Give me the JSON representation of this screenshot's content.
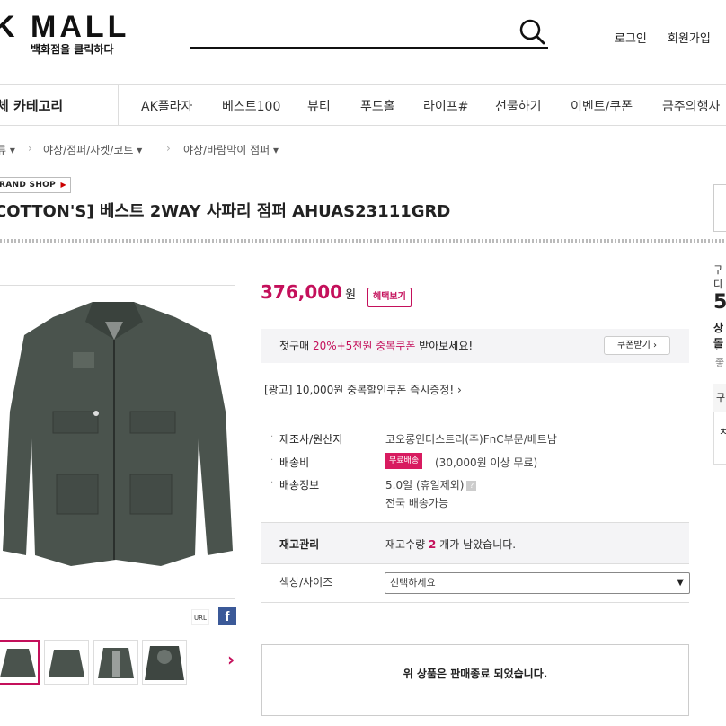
{
  "header": {
    "logo_text": "K MALL",
    "logo_sub": "백화점을 클릭하다",
    "search_placeholder": "",
    "login": "로그인",
    "join": "회원가입"
  },
  "nav": {
    "all_category": "체 카테고리",
    "items": [
      "AK플라자",
      "베스트100",
      "뷰티",
      "푸드홀",
      "라이프#",
      "선물하기",
      "이벤트/쿠폰",
      "금주의행사"
    ]
  },
  "breadcrumb": {
    "items": [
      "류 ▾",
      "야상/점퍼/자켓/코트 ▾",
      "야상/바람막이 점퍼 ▾"
    ]
  },
  "product": {
    "brand_badge": "RAND SHOP",
    "title": "COTTON'S] 베스트 2WAY 사파리 점퍼 AHUAS23111GRD",
    "price": "376,000",
    "price_unit": "원",
    "benefit_button": "혜택보기",
    "coupon": {
      "prefix": "첫구매 ",
      "highlight": "20%+5천원 중복쿠폰",
      "suffix": " 받아보세요!",
      "button": "쿠폰받기 ›"
    },
    "ad_line": "[광고] 10,000원 중복할인쿠폰 즉시증정!  ›",
    "info": {
      "maker_label": "제조사/원산지",
      "maker_value": "코오롱인더스트리(주)FnC부문/베트남",
      "shipping_fee_label": "배송비",
      "free_badge": "무료배송",
      "shipping_fee_value": "(30,000원 이상 무료)",
      "shipping_info_label": "배송정보",
      "shipping_info_line1": "5.0일 (휴일제외)",
      "shipping_info_line2": "전국 배송가능",
      "bullet": "·",
      "q_icon": "?"
    },
    "stock": {
      "label": "재고관리",
      "prefix": "재고수량 ",
      "count": "2",
      "suffix": " 개가 남았습니다."
    },
    "option": {
      "label": "색상/사이즈",
      "selected": "선택하세요"
    },
    "soldout": "위 상품은 판매종료 되었습니다."
  },
  "share": {
    "url": "URL",
    "facebook": "f"
  },
  "side": {
    "label1": "구디",
    "big": "5",
    "label2": "상돌",
    "label3": "· 좋",
    "label4": "구",
    "label5": "ㅊ"
  },
  "colors": {
    "accent": "#c4105b",
    "jacket": "#4a534d",
    "facebook": "#3b5998"
  },
  "icons": {
    "search": "search-icon",
    "chevron": "chevron-right-icon",
    "select_chevron": "chevron-down-icon"
  }
}
